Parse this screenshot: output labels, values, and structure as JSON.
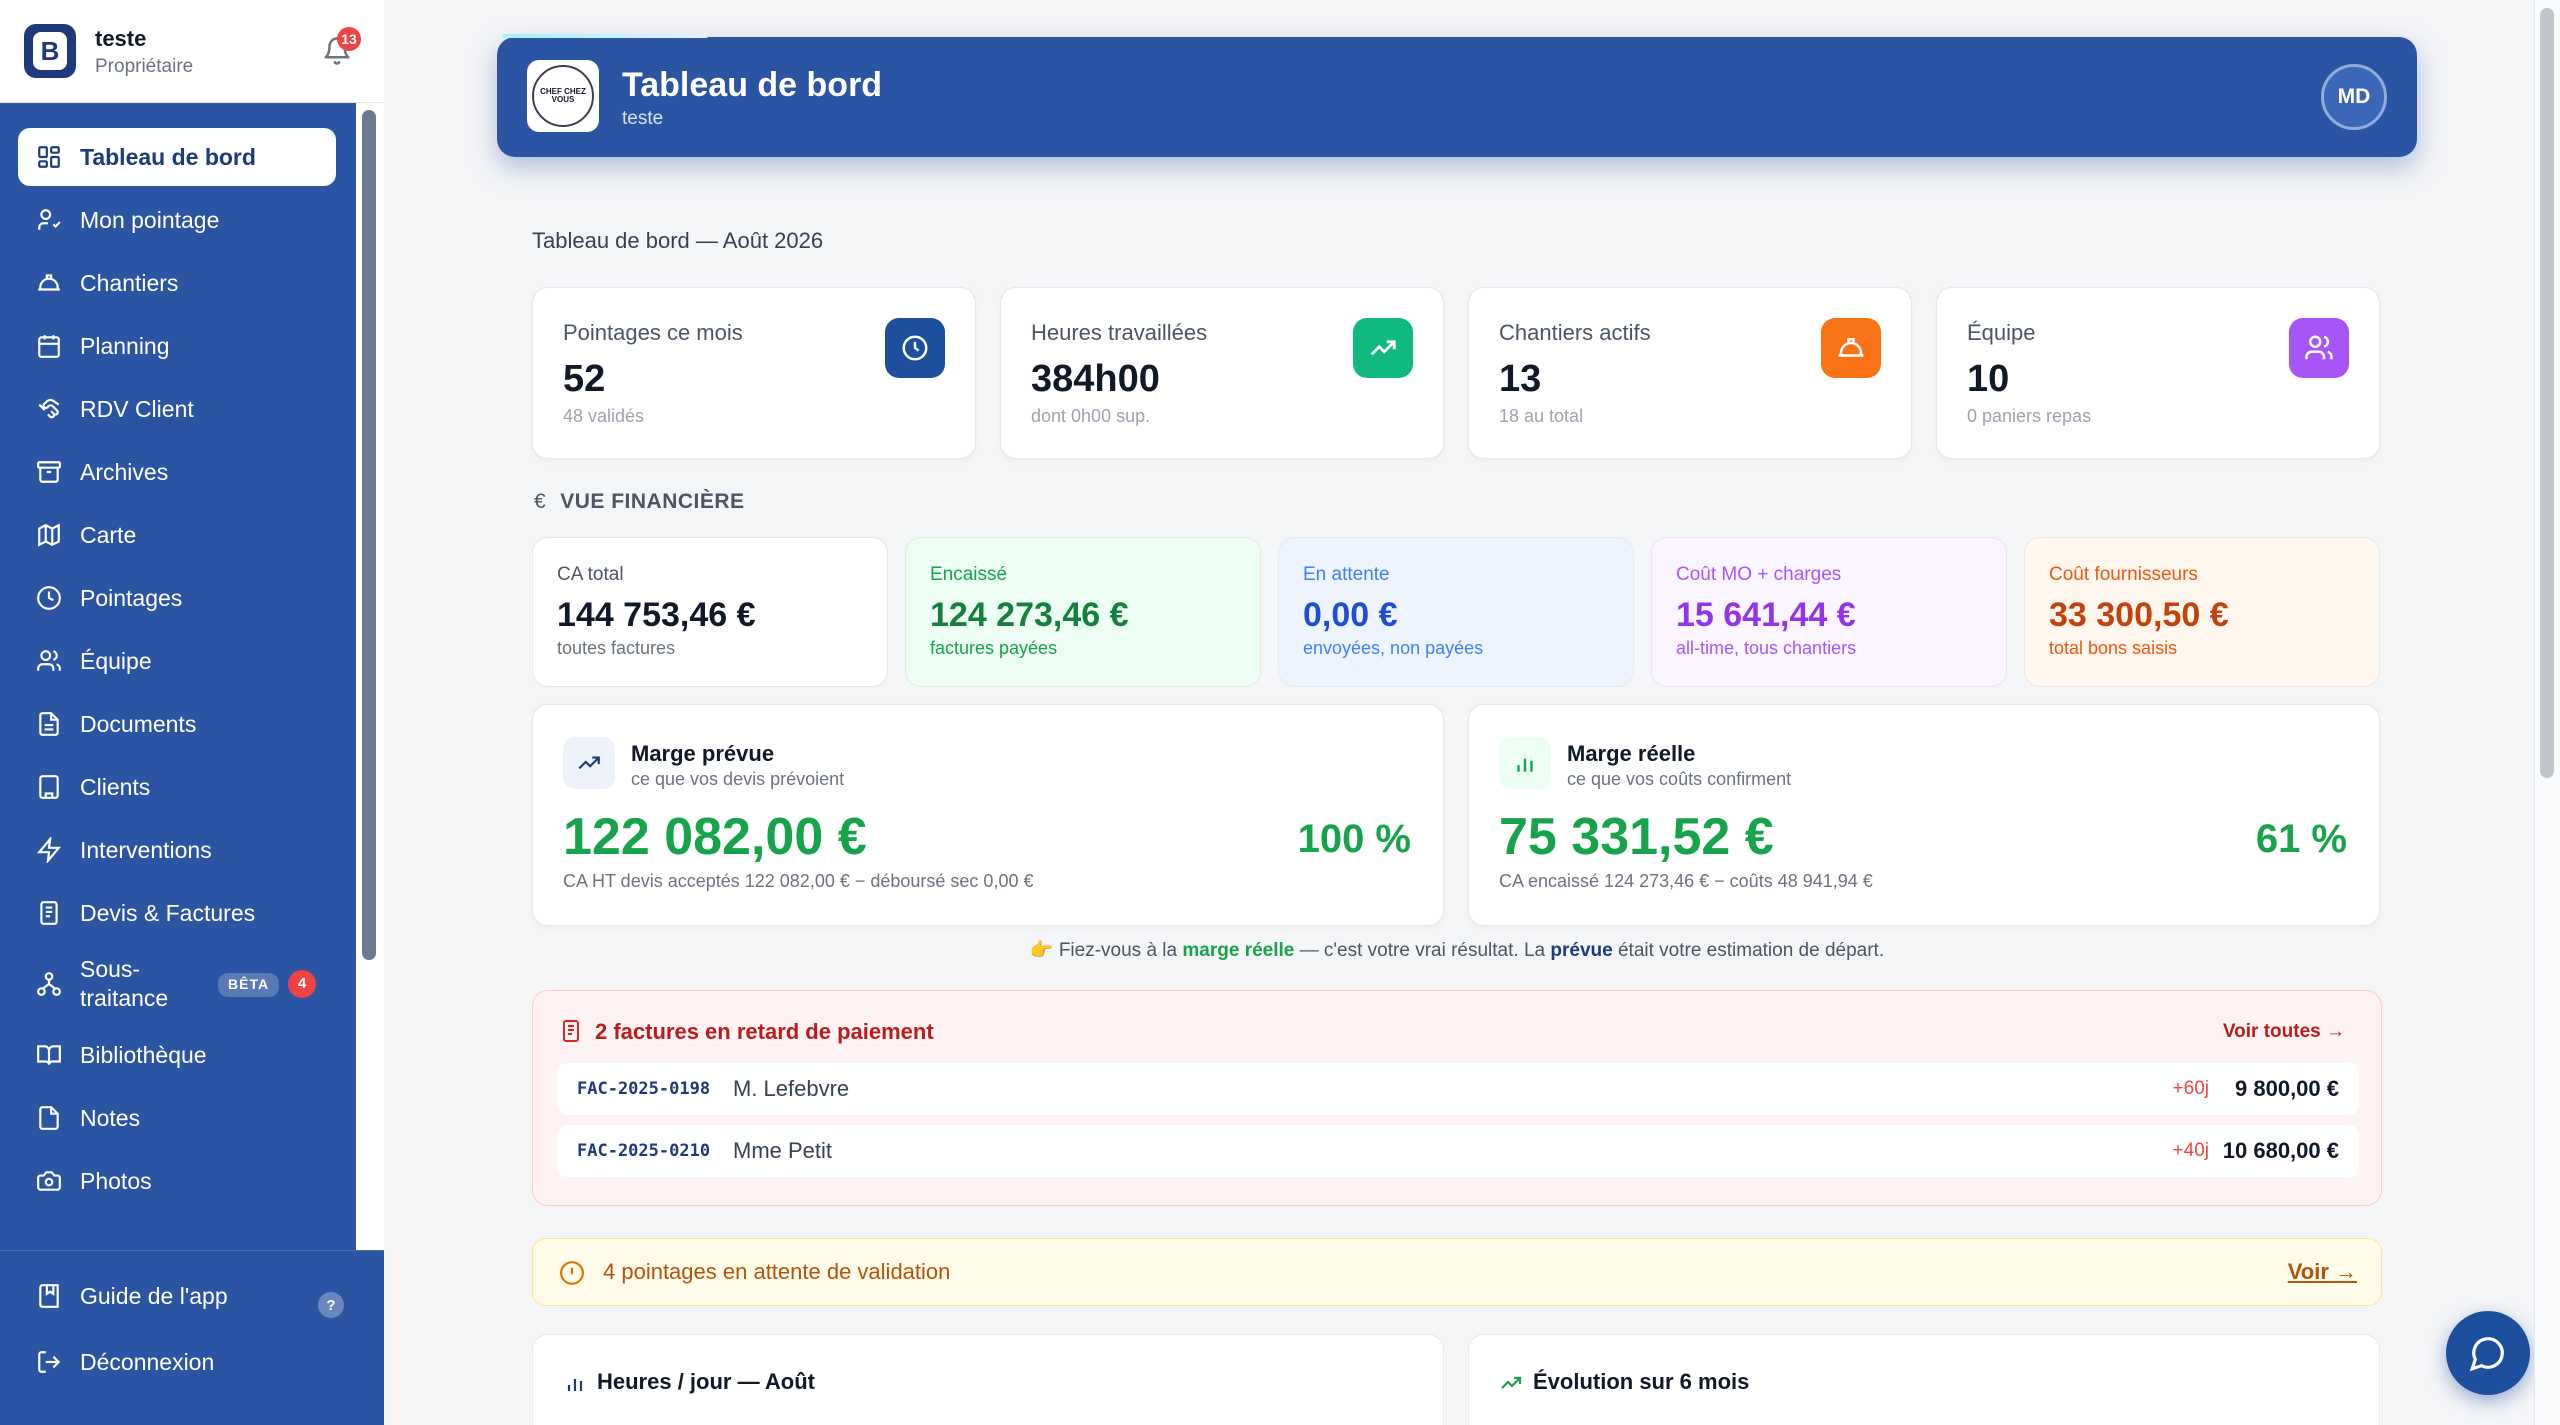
{
  "sidebar": {
    "user": "teste",
    "role": "Propriétaire",
    "notif_count": "13",
    "items": [
      {
        "label": "Tableau de bord",
        "icon": "dashboard-icon",
        "active": true
      },
      {
        "label": "Mon pointage",
        "icon": "user-check-icon"
      },
      {
        "label": "Chantiers",
        "icon": "helmet-icon"
      },
      {
        "label": "Planning",
        "icon": "calendar-icon"
      },
      {
        "label": "RDV Client",
        "icon": "handshake-icon"
      },
      {
        "label": "Archives",
        "icon": "archive-icon"
      },
      {
        "label": "Carte",
        "icon": "map-icon"
      },
      {
        "label": "Pointages",
        "icon": "clock-icon"
      },
      {
        "label": "Équipe",
        "icon": "team-icon"
      },
      {
        "label": "Documents",
        "icon": "document-icon"
      },
      {
        "label": "Clients",
        "icon": "building-icon"
      },
      {
        "label": "Interventions",
        "icon": "bolt-icon"
      },
      {
        "label": "Devis & Factures",
        "icon": "invoice-icon"
      },
      {
        "label": "Sous-\ntraitance",
        "icon": "network-icon",
        "tag": "BÊTA",
        "badge": "4"
      },
      {
        "label": "Bibliothèque",
        "icon": "book-icon"
      },
      {
        "label": "Notes",
        "icon": "note-icon"
      },
      {
        "label": "Photos",
        "icon": "camera-icon"
      }
    ],
    "footer": {
      "guide": "Guide de l'app",
      "guide_badge": "?",
      "logout": "Déconnexion"
    }
  },
  "header": {
    "logo_text": "CHEF CHEZ VOUS",
    "title": "Tableau de bord",
    "subtitle": "teste",
    "avatar": "MD"
  },
  "period_title": "Tableau de bord — Août 2026",
  "kpis": [
    {
      "label": "Pointages ce mois",
      "value": "52",
      "sub": "48 validés",
      "icon": "clock-icon",
      "color": "#1e4f9c"
    },
    {
      "label": "Heures travaillées",
      "value": "384h00",
      "sub": "dont 0h00 sup.",
      "icon": "trend-up-icon",
      "color": "#10b981"
    },
    {
      "label": "Chantiers actifs",
      "value": "13",
      "sub": "18 au total",
      "icon": "helmet-icon",
      "color": "#f97316"
    },
    {
      "label": "Équipe",
      "value": "10",
      "sub": "0 paniers repas",
      "icon": "team-icon",
      "color": "#a855f7"
    }
  ],
  "finance": {
    "heading": "VUE FINANCIÈRE",
    "heading_icon": "€",
    "cards": [
      {
        "label": "CA total",
        "value": "144 753,46 €",
        "sub": "toutes factures",
        "bg": "#ffffff",
        "fg": "#111827",
        "muted": "#6b7280"
      },
      {
        "label": "Encaissé",
        "value": "124 273,46 €",
        "sub": "factures payées",
        "bg": "#ecfdf3",
        "fg": "#15803d",
        "muted": "#16a34a"
      },
      {
        "label": "En attente",
        "value": "0,00 €",
        "sub": "envoyées, non payées",
        "bg": "#eef4fd",
        "fg": "#1d4ed8",
        "muted": "#3b82f6"
      },
      {
        "label": "Coût MO + charges",
        "value": "15 641,44 €",
        "sub": "all-time, tous chantiers",
        "bg": "#faf5ff",
        "fg": "#9333ea",
        "muted": "#a855f7"
      },
      {
        "label": "Coût fournisseurs",
        "value": "33 300,50 €",
        "sub": "total bons saisis",
        "bg": "#fff7ed",
        "fg": "#c2410c",
        "muted": "#ea580c"
      }
    ]
  },
  "marges": [
    {
      "title": "Marge prévue",
      "sub": "ce que vos devis prévoient",
      "value": "122 082,00 €",
      "pct": "100 %",
      "detail": "CA HT devis acceptés 122 082,00 € − déboursé sec 0,00 €",
      "icon": "trend-up-icon"
    },
    {
      "title": "Marge réelle",
      "sub": "ce que vos coûts confirment",
      "value": "75 331,52 €",
      "pct": "61 %",
      "detail": "CA encaissé 124 273,46 € − coûts 48 941,94 €",
      "icon": "bar-chart-icon"
    }
  ],
  "hint": {
    "emoji": "👉",
    "part1": "Fiez-vous à la",
    "strong1": "marge réelle",
    "part2": "— c'est votre vrai résultat. La",
    "strong2": "prévue",
    "part3": "était votre estimation de départ."
  },
  "late": {
    "title": "2 factures en retard de paiement",
    "link": "Voir toutes →",
    "rows": [
      {
        "num": "FAC-2025-0198",
        "client": "M. Lefebvre",
        "days": "+60j",
        "amount": "9 800,00 €"
      },
      {
        "num": "FAC-2025-0210",
        "client": "Mme Petit",
        "days": "+40j",
        "amount": "10 680,00 €"
      }
    ]
  },
  "pending": {
    "text": "4 pointages en attente de validation",
    "link": "Voir →"
  },
  "bottom": [
    {
      "title": "Heures / jour — Août"
    },
    {
      "title": "Évolution sur 6 mois"
    }
  ]
}
